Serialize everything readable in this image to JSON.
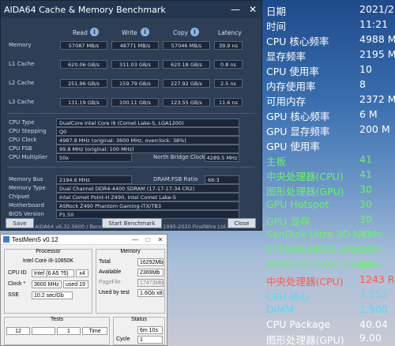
{
  "aida": {
    "title": "AIDA64 Cache & Memory Benchmark",
    "columns": {
      "read": "Read",
      "write": "Write",
      "copy": "Copy",
      "latency": "Latency"
    },
    "rows": [
      {
        "label": "Memory",
        "read": "57087 MB/s",
        "write": "48771 MB/s",
        "copy": "57046 MB/s",
        "latency": "39.9 ns"
      },
      {
        "label": "L1 Cache",
        "read": "620.06 GB/s",
        "write": "311.03 GB/s",
        "copy": "620.18 GB/s",
        "latency": "0.8 ns"
      },
      {
        "label": "L2 Cache",
        "read": "251.96 GB/s",
        "write": "159.79 GB/s",
        "copy": "227.92 GB/s",
        "latency": "2.5 ns"
      },
      {
        "label": "L3 Cache",
        "read": "131.19 GB/s",
        "write": "100.11 GB/s",
        "copy": "123.55 GB/s",
        "latency": "11.6 ns"
      }
    ],
    "cpu": {
      "type_label": "CPU Type",
      "type": "DualCore Intel Core i9  (Comet Lake-S, LGA1200)",
      "stepping_label": "CPU Stepping",
      "stepping": "Q0",
      "clock_label": "CPU Clock",
      "clock": "4987.8 MHz  (original: 3600 MHz, overclock: 38%)",
      "fsb_label": "CPU FSB",
      "fsb": "99.8 MHz  (original: 100 MHz)",
      "mult_label": "CPU Multiplier",
      "mult": "50x",
      "nb_label": "North Bridge Clock",
      "nb": "4289.5 MHz"
    },
    "mem": {
      "bus_label": "Memory Bus",
      "bus": "2194.6 MHz",
      "ratio_label": "DRAM:FSB Ratio",
      "ratio": "66:3",
      "type_label": "Memory Type",
      "type": "Dual Channel DDR4-4400 SDRAM  (17-17-17-34 CR2)",
      "chipset_label": "Chipset",
      "chipset": "Intel Comet Point-H Z490, Intel Comet Lake-S",
      "mobo_label": "Motherboard",
      "mobo": "ASRock Z490 Phantom Gaming-ITX/TB3",
      "bios_label": "BIOS Version",
      "bios": "P1.50"
    },
    "version": "AIDA64 v6.32.5600 / BenchDLL 4.5.841.8-x64  (c) 1995-2020 FinalWire Ltd.",
    "buttons": {
      "save": "Save",
      "start": "Start Benchmark",
      "close": "Close"
    }
  },
  "testmem": {
    "title": "TestMem5 v0.12",
    "processor_title": "Processor",
    "cpu_name": "Intel Core i9-10850K",
    "cpu_id_label": "CPU ID",
    "cpu_id": "Intel  (6 A5 ?5)",
    "threads": "x4",
    "clock_label": "Clock *",
    "clock": "3600 MHz",
    "clock_mult": "used  19",
    "sse_label": "SSE",
    "sse": "10.2 sec/Gb",
    "memory_title": "Memory",
    "total_label": "Total",
    "total": "16292Mb",
    "available_label": "Available",
    "available": "2369Mb",
    "pagefile_label": "PageFile",
    "pagefile": "17473Mb",
    "used_label": "Used by test",
    "used": "1.6Gb x8",
    "tests_title": "Tests",
    "tests_row": [
      "12",
      "",
      "1",
      "Time"
    ],
    "status_title": "Status",
    "status_time": "6m 10s",
    "cycle_label": "Cycle",
    "cycle": "1"
  },
  "sensors": [
    {
      "label": "日期",
      "value": "2021/2",
      "color": "#ffffff"
    },
    {
      "label": "时间",
      "value": "11:21",
      "color": "#ffffff"
    },
    {
      "label": "CPU 核心频率",
      "value": "4988 M",
      "color": "#ffffff"
    },
    {
      "label": "显存频率",
      "value": "2195 M",
      "color": "#ffffff"
    },
    {
      "label": "CPU 使用率",
      "value": "10",
      "color": "#ffffff"
    },
    {
      "label": "内存使用率",
      "value": "8",
      "color": "#ffffff"
    },
    {
      "label": "可用内存",
      "value": "2372 M",
      "color": "#ffffff"
    },
    {
      "label": "GPU 核心频率",
      "value": "6 M",
      "color": "#ffffff"
    },
    {
      "label": "GPU 显存频率",
      "value": "200 M",
      "color": "#ffffff"
    },
    {
      "label": "GPU 使用率",
      "value": "",
      "color": "#ffffff"
    },
    {
      "label": "主板",
      "value": "41",
      "color": "#6cf06c"
    },
    {
      "label": "中央处理器(CPU)",
      "value": "41",
      "color": "#6cf06c"
    },
    {
      "label": "图形处理器(GPU)",
      "value": "30",
      "color": "#6cf06c"
    },
    {
      "label": "GPU Hotspot",
      "value": "30",
      "color": "#6cf06c"
    },
    {
      "label": "GPU 显存",
      "value": "30",
      "color": "#6cf06c"
    },
    {
      "label": "SanDisk Ultra 3D NVMe",
      "value": "41",
      "color": "#6cf06c"
    },
    {
      "label": "ST5000LM000-2AN170",
      "value": "30",
      "color": "#6cf06c"
    },
    {
      "label": "WDS100T3X0C-00SJG0",
      "value": "40",
      "color": "#6cf06c"
    },
    {
      "label": "中央处理器(CPU)",
      "value": "1243 RP",
      "color": "#ff5a4a"
    },
    {
      "label": "CPU 核心",
      "value": "1.252",
      "color": "#5dd6f2"
    },
    {
      "label": "DIMM",
      "value": "1.500",
      "color": "#5dd6f2"
    },
    {
      "label": "CPU Package",
      "value": "40.04",
      "color": "#ffffff"
    },
    {
      "label": "图形处理器(GPU)",
      "value": "9.00",
      "color": "#ffffff"
    }
  ]
}
